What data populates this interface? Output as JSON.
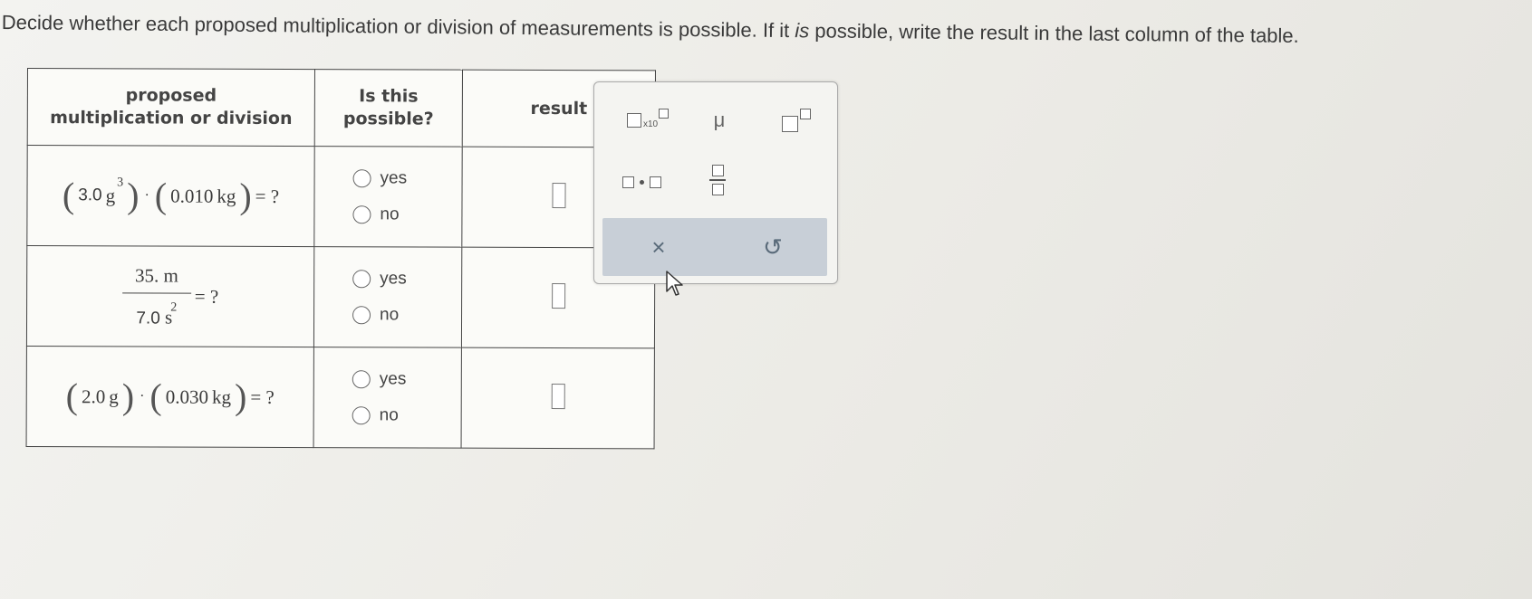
{
  "instructions": {
    "part1": "Decide whether each proposed multiplication or division of measurements is possible. If it ",
    "emph": "is",
    "part2": " possible, write the result in the last column of the table."
  },
  "table": {
    "headers": [
      "proposed\nmultiplication or division",
      "Is this\npossible?",
      "result"
    ],
    "rows": [
      {
        "expr": {
          "a_val": "3.0",
          "a_unit": "g",
          "a_exp": "3",
          "b_val": "0.010",
          "b_unit": "kg",
          "rhs": "= ?"
        },
        "yes": "yes",
        "no": "no"
      },
      {
        "expr": {
          "num": "35. m",
          "den_val": "7.0",
          "den_unit": "s",
          "den_exp": "2",
          "rhs": "= ?"
        },
        "yes": "yes",
        "no": "no"
      },
      {
        "expr": {
          "a_val": "2.0",
          "a_unit": "g",
          "b_val": "0.030",
          "b_unit": "kg",
          "rhs": "= ?"
        },
        "yes": "yes",
        "no": "no"
      }
    ]
  },
  "palette": {
    "sci_label": "x10",
    "mu": "μ",
    "clear": "×",
    "undo": "↺"
  },
  "colors": {
    "accent": "#c8cfd7",
    "icon": "#5a6b7a"
  }
}
